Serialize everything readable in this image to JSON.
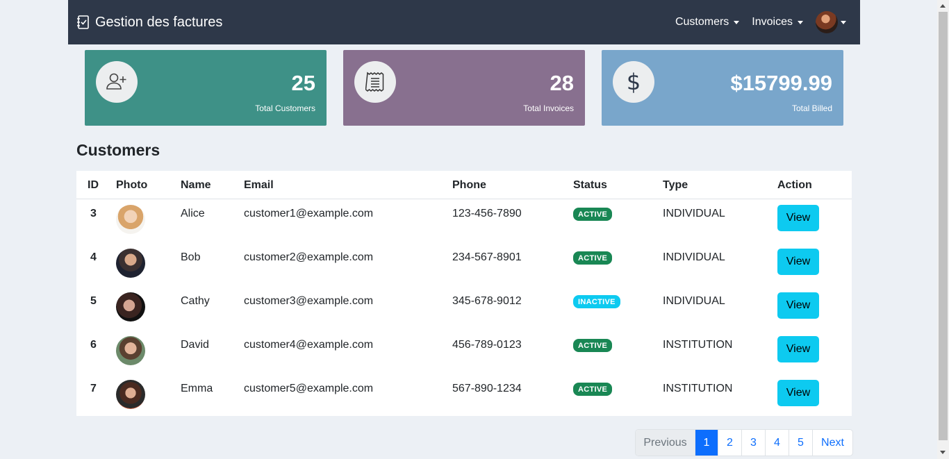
{
  "navbar": {
    "brand": "Gestion des factures",
    "menu": [
      {
        "label": "Customers"
      },
      {
        "label": "Invoices"
      }
    ]
  },
  "stats": [
    {
      "value": "25",
      "label": "Total Customers",
      "color": "#3e9187",
      "icon": "add-user-icon"
    },
    {
      "value": "28",
      "label": "Total Invoices",
      "color": "#88708f",
      "icon": "receipt-icon"
    },
    {
      "value": "$15799.99",
      "label": "Total Billed",
      "color": "#79a6cb",
      "icon": "dollar-icon"
    }
  ],
  "section_title": "Customers",
  "table": {
    "headers": [
      "ID",
      "Photo",
      "Name",
      "Email",
      "Phone",
      "Status",
      "Type",
      "Action"
    ],
    "rows": [
      {
        "id": "3",
        "name": "Alice",
        "email": "customer1@example.com",
        "phone": "123-456-7890",
        "status": "ACTIVE",
        "type": "INDIVIDUAL",
        "action": "View"
      },
      {
        "id": "4",
        "name": "Bob",
        "email": "customer2@example.com",
        "phone": "234-567-8901",
        "status": "ACTIVE",
        "type": "INDIVIDUAL",
        "action": "View"
      },
      {
        "id": "5",
        "name": "Cathy",
        "email": "customer3@example.com",
        "phone": "345-678-9012",
        "status": "INACTIVE",
        "type": "INDIVIDUAL",
        "action": "View"
      },
      {
        "id": "6",
        "name": "David",
        "email": "customer4@example.com",
        "phone": "456-789-0123",
        "status": "ACTIVE",
        "type": "INSTITUTION",
        "action": "View"
      },
      {
        "id": "7",
        "name": "Emma",
        "email": "customer5@example.com",
        "phone": "567-890-1234",
        "status": "ACTIVE",
        "type": "INSTITUTION",
        "action": "View"
      }
    ]
  },
  "status_colors": {
    "ACTIVE": "#198754",
    "INACTIVE": "#0dcaf0"
  },
  "pagination": {
    "previous": "Previous",
    "pages": [
      "1",
      "2",
      "3",
      "4",
      "5"
    ],
    "next": "Next",
    "current": "1"
  }
}
